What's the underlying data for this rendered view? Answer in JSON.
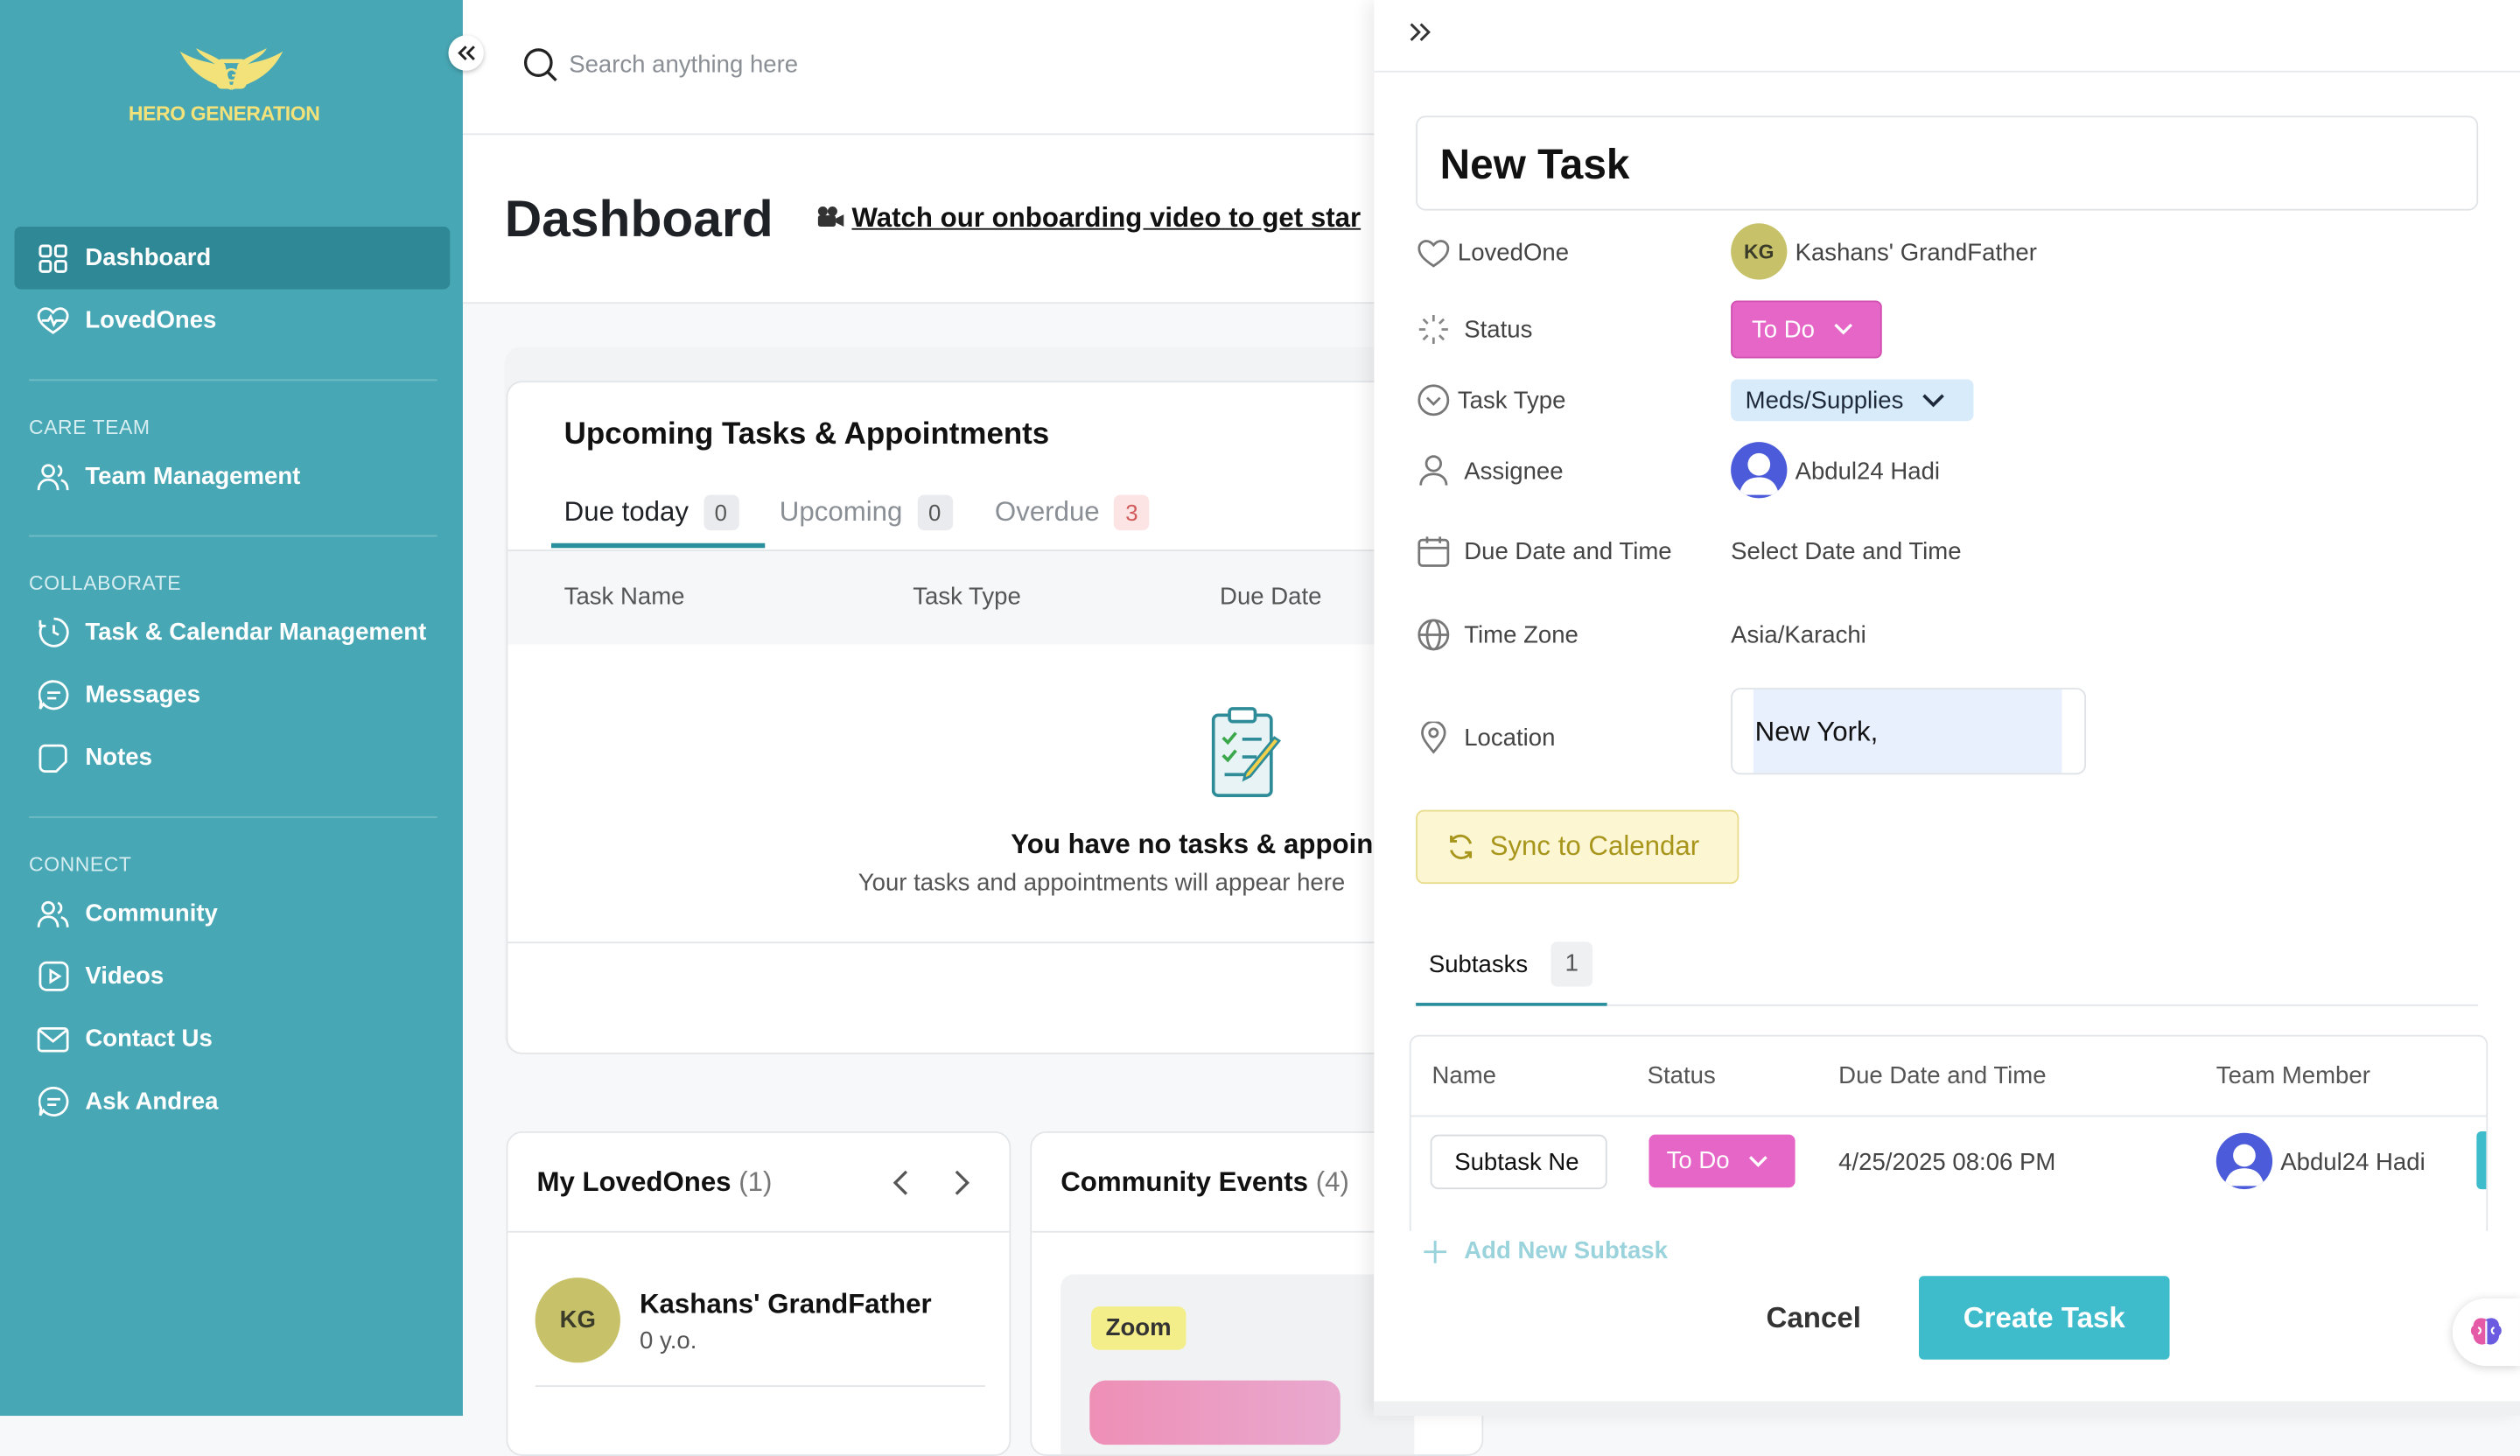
{
  "brand": {
    "name": "HERO GENERATION"
  },
  "sidebar": {
    "items": [
      {
        "label": "Dashboard",
        "icon": "dashboard-icon",
        "active": true
      },
      {
        "label": "LovedOnes",
        "icon": "heart-pulse-icon"
      }
    ],
    "sections": [
      {
        "title": "CARE TEAM",
        "items": [
          {
            "label": "Team Management",
            "icon": "users-icon"
          }
        ]
      },
      {
        "title": "COLLABORATE",
        "items": [
          {
            "label": "Task & Calendar Management",
            "icon": "clock-icon"
          },
          {
            "label": "Messages",
            "icon": "chat-icon"
          },
          {
            "label": "Notes",
            "icon": "note-icon"
          }
        ]
      },
      {
        "title": "CONNECT",
        "items": [
          {
            "label": "Community",
            "icon": "users-icon"
          },
          {
            "label": "Videos",
            "icon": "video-icon"
          },
          {
            "label": "Contact Us",
            "icon": "mail-icon"
          },
          {
            "label": "Ask Andrea",
            "icon": "chat-icon"
          }
        ]
      }
    ]
  },
  "search": {
    "placeholder": "Search anything here"
  },
  "dashboard": {
    "title": "Dashboard",
    "onboarding_link": "Watch our onboarding video to get star",
    "upcoming": {
      "title": "Upcoming Tasks & Appointments",
      "tabs": [
        {
          "label": "Due today",
          "count": "0"
        },
        {
          "label": "Upcoming",
          "count": "0"
        },
        {
          "label": "Overdue",
          "count": "3"
        }
      ],
      "columns": [
        "Task Name",
        "Task Type",
        "Due Date"
      ],
      "empty_title": "You have no tasks & appoin",
      "empty_sub": "Your tasks and appointments will appear here"
    },
    "loved_ones": {
      "title": "My LovedOnes",
      "count": "(1)",
      "person_name": "Kashans' GrandFather",
      "person_initials": "KG",
      "person_age": "0 y.o."
    },
    "community": {
      "title": "Community Events",
      "count": "(4)",
      "tag": "Zoom"
    }
  },
  "task_form": {
    "title": "New Task",
    "fields": {
      "loved_one": {
        "label": "LovedOne",
        "value": "Kashans' GrandFather",
        "initials": "KG"
      },
      "status": {
        "label": "Status",
        "value": "To Do"
      },
      "task_type": {
        "label": "Task Type",
        "value": "Meds/Supplies"
      },
      "assignee": {
        "label": "Assignee",
        "value": "Abdul24 Hadi"
      },
      "due": {
        "label": "Due Date and Time",
        "value": "Select Date and Time"
      },
      "timezone": {
        "label": "Time Zone",
        "value": "Asia/Karachi"
      },
      "location": {
        "label": "Location",
        "value": "New York,"
      }
    },
    "sync_label": "Sync to Calendar",
    "subtasks": {
      "tab_label": "Subtasks",
      "count": "1",
      "columns": [
        "Name",
        "Status",
        "Due Date and Time",
        "Team Member"
      ],
      "rows": [
        {
          "name": "Subtask Ne",
          "status": "To Do",
          "due": "4/25/2025 08:06 PM",
          "member": "Abdul24 Hadi"
        }
      ],
      "add_label": "Add New Subtask"
    },
    "cancel_label": "Cancel",
    "create_label": "Create Task"
  },
  "colors": {
    "sidebar": "#48a7b4",
    "active": "#2f8896",
    "accent": "#3fbccb",
    "status_pink": "#e666c8",
    "type_blue": "#d7ebfb",
    "sync_yellow": "#fdf6d3"
  }
}
